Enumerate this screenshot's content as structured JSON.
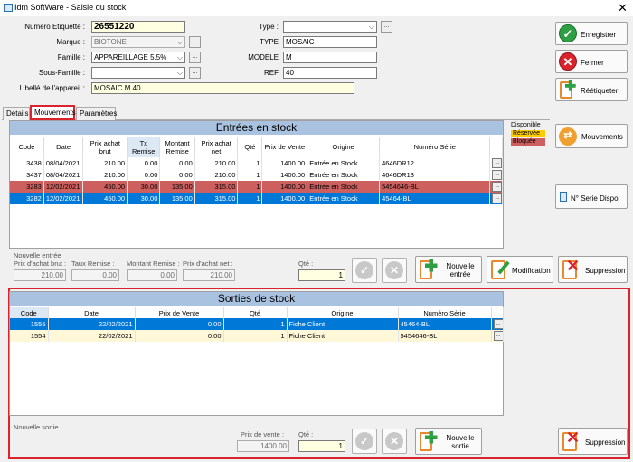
{
  "window": {
    "title": "Idm SoftWare - Saisie du stock",
    "close": "✕"
  },
  "form": {
    "numero_label": "Numero Etiquette :",
    "numero_value": "26551220",
    "marque_label": "Marque :",
    "marque_value": "BIOTONE",
    "famille_label": "Famille :",
    "famille_value": "APPAREILLAGE 5.5%",
    "sousfamille_label": "Sous-Famille :",
    "sousfamille_value": "",
    "libelle_label": "Libellé de l'appareil :",
    "libelle_value": "MOSAIC M 40",
    "type_label": "Type :",
    "type_value": "",
    "type2_label": "TYPE",
    "type2_value": "MOSAIC",
    "modele_label": "MODELE",
    "modele_value": "M",
    "ref_label": "REF",
    "ref_value": "40",
    "ellipsis": "..."
  },
  "actions": {
    "enregistrer": "Enregistrer",
    "fermer": "Fermer",
    "reetiqueter": "Réétiqueter"
  },
  "tabs": [
    {
      "label": "Détails"
    },
    {
      "label": "Mouvements"
    },
    {
      "label": "Paramètres"
    }
  ],
  "legend": {
    "disponible": "Disponible",
    "reservee": "Réservée",
    "bloquee": "Bloquée",
    "colors": {
      "reservee": "#ffcc00",
      "bloquee": "#cd5f5f"
    }
  },
  "side_buttons": {
    "mouvements": "Mouvements",
    "serie": "N° Serie Dispo."
  },
  "entrees": {
    "title": "Entrées en stock",
    "headers": [
      "Code",
      "Date",
      "Prix achat brut",
      "Tx Remise",
      "Montant Remise",
      "Prix achat net",
      "Qté",
      "Prix de Vente",
      "Origine",
      "Numéro Série"
    ],
    "rows": [
      {
        "code": "3438",
        "date": "08/04/2021",
        "brut": "210.00",
        "tx": "0.00",
        "montant": "0.00",
        "net": "210.00",
        "qte": "1",
        "vente": "1400.00",
        "origine": "Entrée en Stock",
        "serie": "4646DR12",
        "state": "white"
      },
      {
        "code": "3437",
        "date": "08/04/2021",
        "brut": "210.00",
        "tx": "0.00",
        "montant": "0.00",
        "net": "210.00",
        "qte": "1",
        "vente": "1400.00",
        "origine": "Entrée en Stock",
        "serie": "4646DR13",
        "state": "white"
      },
      {
        "code": "3283",
        "date": "12/02/2021",
        "brut": "450.00",
        "tx": "30.00",
        "montant": "135.00",
        "net": "315.00",
        "qte": "1",
        "vente": "1400.00",
        "origine": "Entrée en Stock",
        "serie": "5454646-BL",
        "state": "red"
      },
      {
        "code": "3282",
        "date": "12/02/2021",
        "brut": "450.00",
        "tx": "30.00",
        "montant": "135.00",
        "net": "315.00",
        "qte": "1",
        "vente": "1400.00",
        "origine": "Entrée en Stock",
        "serie": "45464-BL",
        "state": "blue"
      }
    ],
    "nouvelle_label": "Nouvelle entrée",
    "prix_brut_label": "Prix d'achat brut :",
    "prix_brut_value": "210.00",
    "taux_label": "Taux Remise :",
    "taux_value": "0.00",
    "montant_label": "Montant Remise :",
    "montant_value": "0.00",
    "prix_net_label": "Prix d'achat net :",
    "prix_net_value": "210.00",
    "qte_label": "Qté :",
    "qte_value": "1",
    "nouvelle_btn_1": "Nouvelle",
    "nouvelle_btn_2": "entrée",
    "modification": "Modification",
    "suppression": "Suppression"
  },
  "sorties": {
    "title": "Sorties de stock",
    "headers": [
      "Code",
      "Date",
      "Prix de Vente",
      "Qté",
      "Origine",
      "Numéro Série"
    ],
    "rows": [
      {
        "code": "1555",
        "date": "22/02/2021",
        "vente": "0.00",
        "qte": "1",
        "origine": "Fiche Client",
        "serie": "45464-BL",
        "state": "blue"
      },
      {
        "code": "1554",
        "date": "22/02/2021",
        "vente": "0.00",
        "qte": "1",
        "origine": "Fiche Client",
        "serie": "5454646-BL",
        "state": "yellow"
      }
    ],
    "nouvelle_label": "Nouvelle sortie",
    "prix_label": "Prix de vente :",
    "prix_value": "1400.00",
    "qte_label": "Qté :",
    "qte_value": "1",
    "nouvelle_btn_1": "Nouvelle",
    "nouvelle_btn_2": "sortie",
    "suppression": "Suppression"
  },
  "icons": {
    "ok": "✓",
    "cancel": "✕",
    "row_ellipsis": "...",
    "dropdown": "⌵"
  }
}
